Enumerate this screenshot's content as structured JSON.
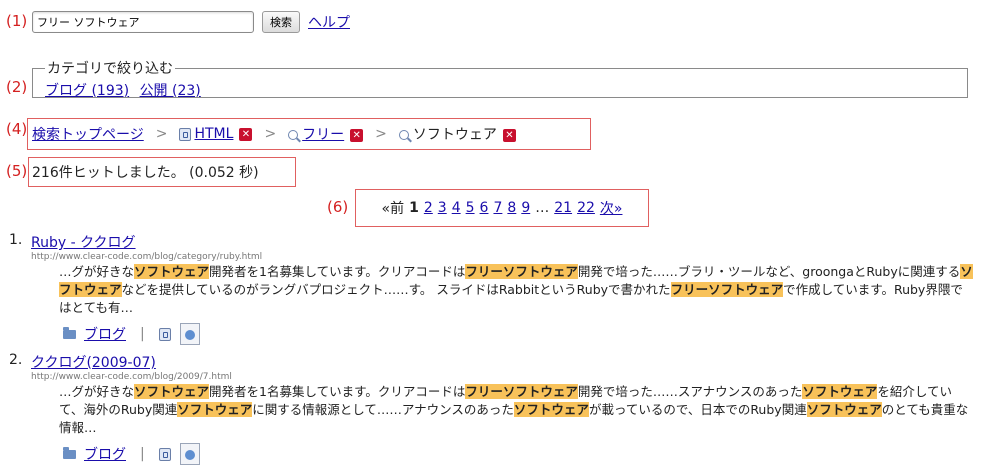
{
  "markers": [
    "(1)",
    "(2)",
    "(4)",
    "(5)",
    "(6)"
  ],
  "search": {
    "value": "フリー ソフトウェア",
    "button_label": "検索",
    "help_label": "ヘルプ"
  },
  "category": {
    "legend": "カテゴリで絞り込む",
    "items": [
      {
        "label": "ブログ (193)"
      },
      {
        "label": "公開 (23)"
      }
    ]
  },
  "breadcrumb": {
    "top_label": "検索トップページ",
    "separator": ">",
    "items": [
      {
        "label": "HTML",
        "icon": "site-icon",
        "remove": "✕"
      },
      {
        "label": "フリー",
        "icon": "search-icon",
        "remove": "✕"
      },
      {
        "label": "ソフトウェア",
        "icon": "search-icon",
        "remove": "✕"
      }
    ]
  },
  "hits": {
    "text": "216件ヒットしました。 (0.052 秒)"
  },
  "pager": {
    "prev": "«前",
    "current": "1",
    "pages": [
      "2",
      "3",
      "4",
      "5",
      "6",
      "7",
      "8",
      "9"
    ],
    "ellipsis": "…",
    "tail_pages": [
      "21",
      "22"
    ],
    "next": "次»"
  },
  "results": [
    {
      "num": "1.",
      "title": "Ruby - ククログ",
      "url": "http://www.clear-code.com/blog/category/ruby.html",
      "snippet": [
        {
          "t": "…グが好きな"
        },
        {
          "t": "ソフトウェア",
          "hl": true
        },
        {
          "t": "開発者を1名募集しています。クリアコードは"
        },
        {
          "t": "フリーソフトウェア",
          "hl": true
        },
        {
          "t": "開発で培った……ブラリ・ツールなど、groongaとRubyに関連する"
        },
        {
          "t": "ソフトウェア",
          "hl": true
        },
        {
          "t": "などを提供しているのがラングバプロジェクト……す。 スライドはRabbitというRubyで書かれた"
        },
        {
          "t": "フリーソフトウェア",
          "hl": true
        },
        {
          "t": "で作成しています。Ruby界隈ではとても有…"
        }
      ],
      "category_link": "ブログ",
      "pipe": "|"
    },
    {
      "num": "2.",
      "title": "ククログ(2009-07)",
      "url": "http://www.clear-code.com/blog/2009/7.html",
      "snippet": [
        {
          "t": "…グが好きな"
        },
        {
          "t": "ソフトウェア",
          "hl": true
        },
        {
          "t": "開発者を1名募集しています。クリアコードは"
        },
        {
          "t": "フリーソフトウェア",
          "hl": true
        },
        {
          "t": "開発で培った……スアナウンスのあった"
        },
        {
          "t": "ソフトウェア",
          "hl": true
        },
        {
          "t": "を紹介していて、海外のRuby関連"
        },
        {
          "t": "ソフトウェア",
          "hl": true
        },
        {
          "t": "に関する情報源として……アナウンスのあった"
        },
        {
          "t": "ソフトウェア",
          "hl": true
        },
        {
          "t": "が載っているので、日本でのRuby関連"
        },
        {
          "t": "ソフトウェア",
          "hl": true
        },
        {
          "t": "のとても貴重な情報…"
        }
      ],
      "category_link": "ブログ",
      "pipe": "|"
    }
  ],
  "colors": {
    "link": "#1a0dab",
    "marker": "#d42020",
    "highlight": "#f8c25a",
    "annotation_box": "#e06060",
    "remove_button": "#c8102e"
  }
}
